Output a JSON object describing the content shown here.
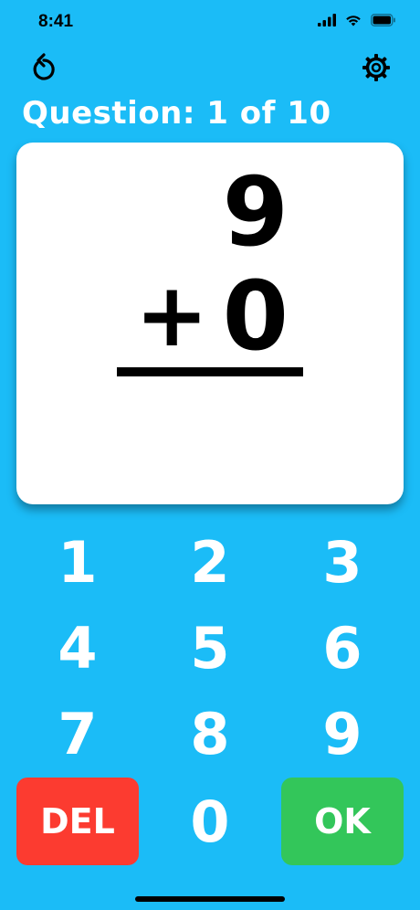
{
  "status_bar": {
    "time": "8:41",
    "icons": [
      "signal-icon",
      "wifi-icon",
      "battery-icon"
    ]
  },
  "toolbar": {
    "left_icon": "reset-icon",
    "right_icon": "gear-icon"
  },
  "question": {
    "label": "Question: 1 of 10"
  },
  "problem": {
    "top_operand": "9",
    "operator": "+",
    "bottom_operand": "0"
  },
  "keypad": {
    "keys": [
      "1",
      "2",
      "3",
      "4",
      "5",
      "6",
      "7",
      "8",
      "9"
    ],
    "zero": "0",
    "delete_label": "DEL",
    "ok_label": "OK"
  },
  "colors": {
    "background": "#1bbcf7",
    "delete": "#fc3b30",
    "ok": "#33c65a"
  }
}
